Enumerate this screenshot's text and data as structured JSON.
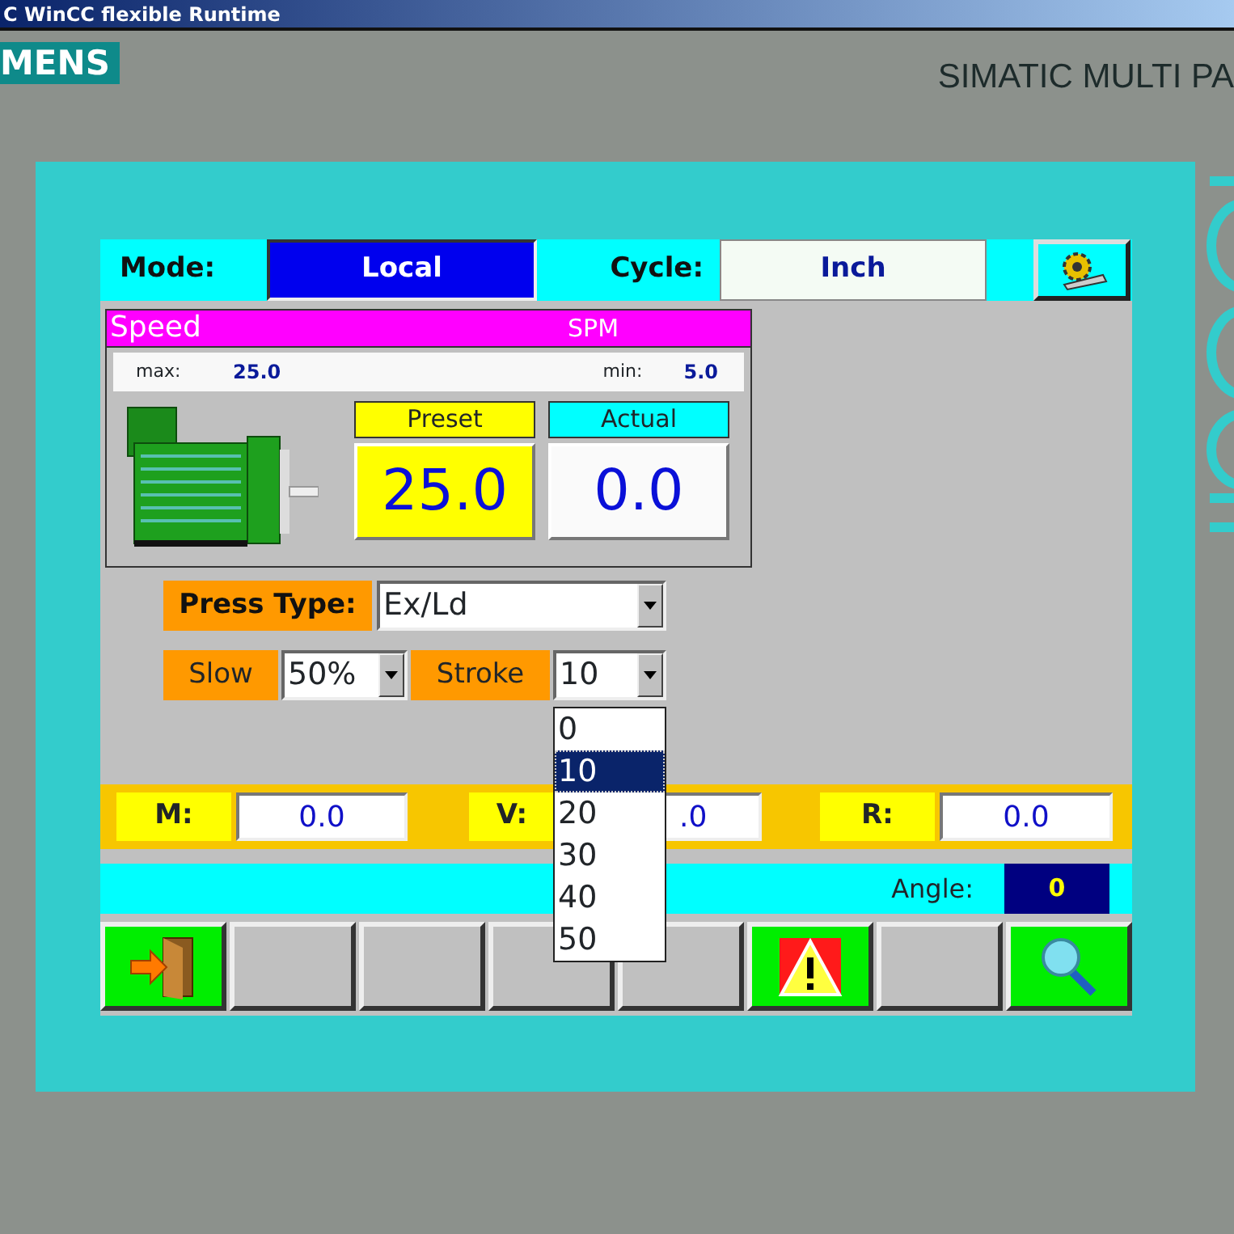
{
  "window": {
    "title": "C WinCC flexible Runtime"
  },
  "bezel": {
    "brand": "MENS",
    "model": "SIMATIC MULTI PA"
  },
  "header": {
    "mode_label": "Mode:",
    "mode_value": "Local",
    "cycle_label": "Cycle:",
    "cycle_value": "Inch"
  },
  "speed": {
    "title": "Speed",
    "unit": "SPM",
    "max_label": "max:",
    "max_value": "25.0",
    "min_label": "min:",
    "min_value": "5.0",
    "preset_label": "Preset",
    "preset_value": "25.0",
    "actual_label": "Actual",
    "actual_value": "0.0"
  },
  "press_type": {
    "label": "Press Type:",
    "value": "Ex/Ld"
  },
  "slow": {
    "label": "Slow",
    "value": "50%"
  },
  "stroke": {
    "label": "Stroke",
    "value": "10",
    "expanded": true,
    "options": [
      {
        "label": "0",
        "selected": false
      },
      {
        "label": "10",
        "selected": true
      },
      {
        "label": "20",
        "selected": false
      },
      {
        "label": "30",
        "selected": false
      },
      {
        "label": "40",
        "selected": false
      },
      {
        "label": "50",
        "selected": false
      }
    ]
  },
  "readings": [
    {
      "label": "M:",
      "value": "0.0"
    },
    {
      "label": "V:",
      "value": ".0"
    },
    {
      "label": "R:",
      "value": "0.0"
    }
  ],
  "angle": {
    "label": "Angle:",
    "value": "0"
  },
  "function_keys": [
    {
      "kind": "exit"
    },
    {
      "kind": "blank"
    },
    {
      "kind": "blank"
    },
    {
      "kind": "blank"
    },
    {
      "kind": "blank"
    },
    {
      "kind": "alarm"
    },
    {
      "kind": "blank"
    },
    {
      "kind": "search"
    }
  ]
}
